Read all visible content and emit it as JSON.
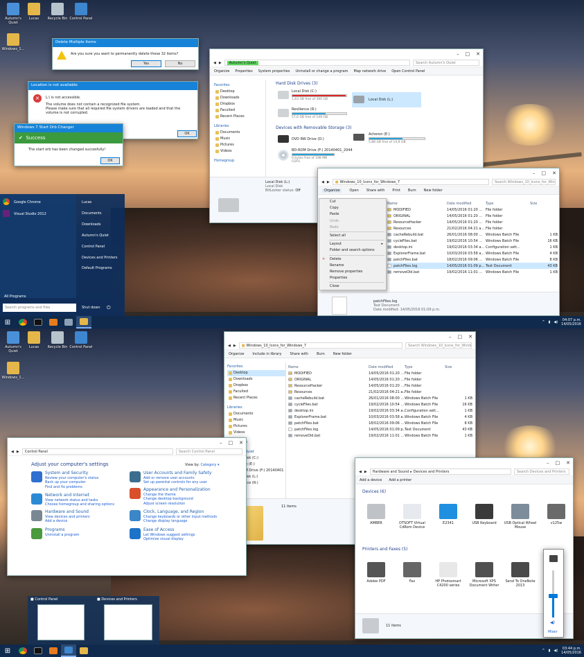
{
  "desktop_icons": [
    "Autumn's Quiet",
    "Lucas",
    "Recycle Bin",
    "Control Panel",
    "Windows_1..."
  ],
  "taskbar": {
    "top_clock": {
      "time": "04:07 p.m.",
      "date": "14/05/2016"
    },
    "bottom_clock": {
      "time": "03:44 p.m.",
      "date": "14/05/2016"
    }
  },
  "delete_dialog": {
    "title": "Delete Multiple Items",
    "message": "Are you sure you want to permanently delete these 32 items?",
    "yes": "Yes",
    "no": "No"
  },
  "location_dialog": {
    "title": "Location is not available",
    "line1": "L:\\ is not accessible.",
    "line2": "The volume does not contain a recognized file system.",
    "line3": "Please make sure that all required file system drivers are loaded and that the volume is not corrupted.",
    "ok": "OK"
  },
  "orb_dialog": {
    "title": "Windows 7 Start Orb Changer",
    "header": "Success",
    "message": "The start orb has been changed succesfully!",
    "ok": "OK"
  },
  "start_menu": {
    "pinned": [
      "Google Chrome",
      "Visual Studio 2012"
    ],
    "right": [
      "Lucas",
      "Documents",
      "Downloads",
      "Autumn's Quiet",
      "Control Panel",
      "Devices and Printers",
      "Default Programs"
    ],
    "all_programs": "All Programs",
    "search_placeholder": "Search programs and files",
    "shutdown": "Shut down"
  },
  "computer_window": {
    "address": "Autumn's Quiet",
    "search": "Search Autumn's Quiet",
    "toolbar": [
      "Organize",
      "Properties",
      "System properties",
      "Uninstall or change a program",
      "Map network drive",
      "Open Control Panel"
    ],
    "nav_favorites": [
      "Desktop",
      "Downloads",
      "Dropbox",
      "Faculted",
      "Recent Places"
    ],
    "nav_libraries": [
      "Documents",
      "Music",
      "Pictures",
      "Videos"
    ],
    "nav_headers": {
      "favorites": "Favorites",
      "libraries": "Libraries",
      "homegroup": "Homegroup"
    },
    "group_hdd": "Hard Disk Drives (3)",
    "group_removable": "Devices with Removable Storage (3)",
    "drives": [
      {
        "name": "Local Disk (C:)",
        "free": "1,63 GB free of 300 GB",
        "fill": 0.99,
        "color": "#da2626"
      },
      {
        "name": "Local Disk (L:)",
        "free": "",
        "fill": 0,
        "color": "#26a0da"
      },
      {
        "name": "Resilience (R:)",
        "free": "57,6 GB free of 149 GB",
        "fill": 0.61,
        "color": "#26a0da"
      }
    ],
    "removable": [
      {
        "name": "DVD RW Drive (D:)",
        "free": "",
        "fill": 0
      },
      {
        "name": "Acheron (E:)",
        "free": "5,88 GB free of 14,9 GB",
        "fill": 0.6
      },
      {
        "name": "BD-ROM Drive (F:) 20140401_2044",
        "free": "0 bytes free of 198 MB",
        "fill": 1
      },
      {
        "name": "CDFS",
        "free": "",
        "fill": 0
      }
    ],
    "details": {
      "name": "Local Disk (L:)",
      "type": "Local Disk",
      "bitlocker_label": "BitLocker status:",
      "bitlocker_value": "Off"
    }
  },
  "explorer_top": {
    "address": "Windows_10_Icons_for_Windows_7",
    "search": "Search Windows_10_Icons_for_Windo...",
    "toolbar": [
      "Organize",
      "Open",
      "Share with",
      "Print",
      "Burn",
      "New folder"
    ],
    "columns": [
      "Name",
      "Date modified",
      "Type",
      "Size"
    ],
    "files": [
      {
        "name": "MODIFIED",
        "date": "14/05/2016 01:20 ...",
        "type": "File folder",
        "size": ""
      },
      {
        "name": "ORIGINAL",
        "date": "14/05/2016 01:20 ...",
        "type": "File folder",
        "size": ""
      },
      {
        "name": "ResourceHacker",
        "date": "14/05/2016 01:20 ...",
        "type": "File folder",
        "size": ""
      },
      {
        "name": "Resources",
        "date": "21/02/2016 04:21 a...",
        "type": "File folder",
        "size": ""
      },
      {
        "name": "cacheRebuild.bat",
        "date": "26/01/2016 08:00 ...",
        "type": "Windows Batch File",
        "size": "1 KB"
      },
      {
        "name": "cycleFiles.bat",
        "date": "19/02/2016 10:54 ...",
        "type": "Windows Batch File",
        "size": "16 KB"
      },
      {
        "name": "desktop.ini",
        "date": "19/02/2016 03:34 a...",
        "type": "Configuration sett...",
        "size": "1 KB"
      },
      {
        "name": "ExplorerFrame.bat",
        "date": "10/03/2016 03:58 a...",
        "type": "Windows Batch File",
        "size": "4 KB"
      },
      {
        "name": "patchFiles.bat",
        "date": "18/02/2016 09:06 ...",
        "type": "Windows Batch File",
        "size": "8 KB"
      },
      {
        "name": "patchFiles.log",
        "date": "14/05/2016 01:09 p...",
        "type": "Text Document",
        "size": "43 KB"
      },
      {
        "name": "removeOld.bat",
        "date": "19/02/2016 11:01 ...",
        "type": "Windows Batch File",
        "size": "1 KB"
      }
    ],
    "details": {
      "name": "patchFiles.log",
      "type": "Text Document",
      "date": "Date modified: 14/05/2016 01:09 p.m."
    }
  },
  "context_menu": [
    {
      "label": "Cut",
      "enabled": true
    },
    {
      "label": "Copy",
      "enabled": true
    },
    {
      "label": "Paste",
      "enabled": true
    },
    {
      "label": "Undo",
      "enabled": false
    },
    {
      "label": "Redo",
      "enabled": false
    },
    {
      "label": "-"
    },
    {
      "label": "Select all",
      "enabled": true
    },
    {
      "label": "-"
    },
    {
      "label": "Layout",
      "enabled": true
    },
    {
      "label": "Folder and search options",
      "enabled": true
    },
    {
      "label": "-"
    },
    {
      "label": "Delete",
      "enabled": true
    },
    {
      "label": "Rename",
      "enabled": true
    },
    {
      "label": "Remove properties",
      "enabled": true
    },
    {
      "label": "Properties",
      "enabled": true
    },
    {
      "label": "-"
    },
    {
      "label": "Close",
      "enabled": true
    }
  ],
  "explorer_bottom": {
    "address": "Windows_10_Icons_for_Windows_7",
    "search": "Search Windows_10_Icons_for_Windows_7",
    "toolbar": [
      "Organize",
      "Include in library",
      "Share with",
      "Burn",
      "New folder"
    ],
    "nav_favorites": [
      "Desktop",
      "Downloads",
      "Dropbox",
      "Faculted",
      "Recent Places"
    ],
    "nav_libraries": [
      "Documents",
      "Music",
      "Pictures",
      "Videos"
    ],
    "nav_computer": [
      "Local Disk (C:)",
      "Acheron (E:)",
      "BD-ROM Drive (F:) 20140401",
      "Local Disk (L:)",
      "Resilience (R:)"
    ],
    "nav_headers": {
      "favorites": "Favorites",
      "libraries": "Libraries",
      "homegroup": "Homegroup",
      "computer": "Autumn's Quiet",
      "network": "Network"
    },
    "count": "11 items"
  },
  "control_panel": {
    "address": "Control Panel",
    "search": "Search Control Panel",
    "heading": "Adjust your computer's settings",
    "viewby_label": "View by:",
    "viewby_value": "Category",
    "categories": [
      {
        "title": "System and Security",
        "links": [
          "Review your computer's status",
          "Back up your computer",
          "Find and fix problems"
        ],
        "color": "#2f6fd0"
      },
      {
        "title": "Network and Internet",
        "links": [
          "View network status and tasks",
          "Choose homegroup and sharing options"
        ],
        "color": "#2b8ad6"
      },
      {
        "title": "Hardware and Sound",
        "links": [
          "View devices and printers",
          "Add a device"
        ],
        "color": "#7a8894"
      },
      {
        "title": "Programs",
        "links": [
          "Uninstall a program"
        ],
        "color": "#4a9a3e"
      },
      {
        "title": "User Accounts and Family Safety",
        "links": [
          "Add or remove user accounts",
          "Set up parental controls for any user"
        ],
        "color": "#3b6e8e"
      },
      {
        "title": "Appearance and Personalization",
        "links": [
          "Change the theme",
          "Change desktop background",
          "Adjust screen resolution"
        ],
        "color": "#d94f2c"
      },
      {
        "title": "Clock, Language, and Region",
        "links": [
          "Change keyboards or other input methods",
          "Change display language"
        ],
        "color": "#3a86c8"
      },
      {
        "title": "Ease of Access",
        "links": [
          "Let Windows suggest settings",
          "Optimize visual display"
        ],
        "color": "#1d73c9"
      }
    ]
  },
  "devices_window": {
    "address_parts": [
      "Hardware and Sound",
      "Devices and Printers"
    ],
    "search": "Search Devices and Printers",
    "toolbar": [
      "Add a device",
      "Add a printer"
    ],
    "devices_header": "Devices (6)",
    "devices": [
      "AMBER",
      "DTSOFT Virtual CdRom Device",
      "E2341",
      "USB Keyboard",
      "USB Optical Wheel Mouse",
      "v125w"
    ],
    "printers_header": "Printers and Faxes (5)",
    "printers": [
      "Adobe PDF",
      "Fax",
      "HP Photosmart C4200 series",
      "Microsoft XPS Document Writer",
      "Send To OneNote 2013"
    ],
    "count": "11 items"
  },
  "volume_mixer": {
    "label": "Mixer",
    "level": 0.45
  },
  "thumbnails": [
    "Control Panel",
    "Devices and Printers"
  ],
  "colors": {
    "accent": "#1683d8",
    "taskbar": "#0f2a4c",
    "selection": "#cce8ff",
    "link": "#1a5ccf"
  }
}
